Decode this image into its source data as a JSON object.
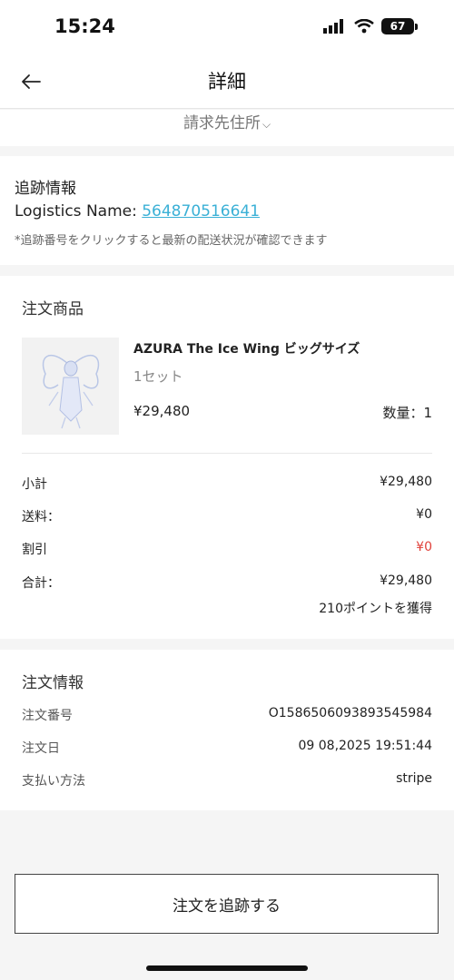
{
  "status": {
    "time": "15:24",
    "battery": "67"
  },
  "nav": {
    "title": "詳細"
  },
  "billing": {
    "label": "請求先住所",
    "chevron": "⌵"
  },
  "tracking": {
    "title": "追跡情報",
    "logistics_label": "Logistics Name: ",
    "tracking_number": "564870516641",
    "note": "*追跡番号をクリックすると最新の配送状況が確認できます"
  },
  "products": {
    "title": "注文商品",
    "items": [
      {
        "name": "AZURA The Ice Wing ビッグサイズ",
        "set": "1セット",
        "price": "¥29,480",
        "qty": "数量：1"
      }
    ],
    "summary": {
      "subtotal_label": "小計",
      "subtotal_value": "¥29,480",
      "shipping_label": "送料：",
      "shipping_value": "¥0",
      "discount_label": "割引",
      "discount_value": "¥0",
      "total_label": "合計：",
      "total_value": "¥29,480",
      "points": "210ポイントを獲得"
    }
  },
  "order_info": {
    "title": "注文情報",
    "order_no_label": "注文番号",
    "order_no_value": "O15865060938935459​84",
    "order_date_label": "注文日",
    "order_date_value": "09 08,2025 19:51:44",
    "payment_label": "支払い方法",
    "payment_value": "stripe"
  },
  "actions": {
    "track_order": "注文を追跡する"
  },
  "colors": {
    "link": "#3ab0d6",
    "discount": "#e0403a"
  }
}
